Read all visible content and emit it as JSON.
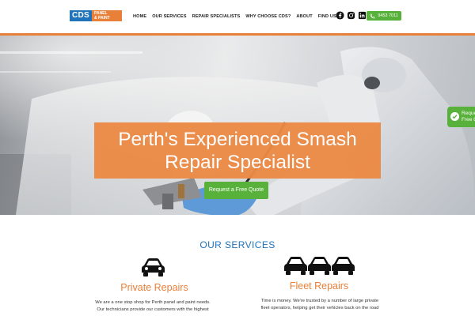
{
  "header": {
    "logo": {
      "cds": "CDS",
      "panel": "PANEL",
      "paint": "& PAINT"
    },
    "nav": [
      "HOME",
      "OUR SERVICES",
      "REPAIR SPECIALISTS",
      "WHY CHOOSE CDS?",
      "ABOUT",
      "FIND US"
    ],
    "social_icons": [
      "facebook-icon",
      "instagram-icon",
      "linkedin-icon"
    ],
    "phone": "9453 7011"
  },
  "hero": {
    "title_line1": "Perth's Experienced Smash",
    "title_line2": "Repair Specialist",
    "cta": "Request a Free Quote",
    "side_quote_line1": "Reque",
    "side_quote_line2": "Free Q"
  },
  "services": {
    "title": "OUR SERVICES",
    "private": {
      "heading": "Private Repairs",
      "line1": "We are a one stop shop for Perth panel and paint needs.",
      "line2": "Our technicians provide our customers with the highest"
    },
    "fleet": {
      "heading": "Fleet Repairs",
      "line1": "Time is money. We're trusted by a number of large private",
      "line2": "fleet operators, helping get their vehicles back on the road"
    }
  },
  "colors": {
    "brand_blue": "#1f74bb",
    "brand_orange": "#e8803a",
    "accent_green": "#58b13a"
  }
}
